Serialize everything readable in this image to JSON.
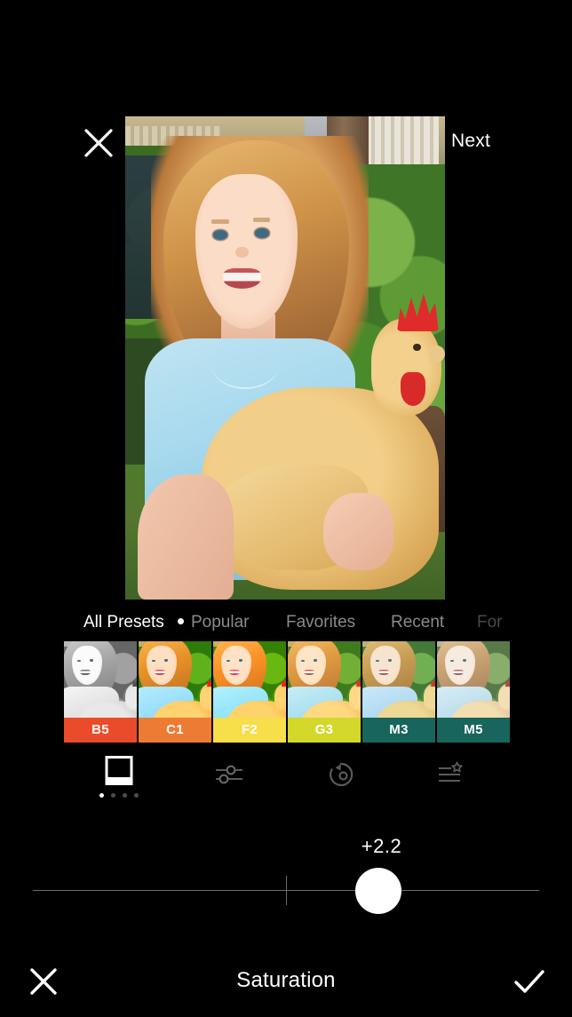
{
  "header": {
    "close_icon": "close-icon",
    "next_label": "Next"
  },
  "photo": {
    "description": "Girl in light blue shirt holding a buff chicken outdoors"
  },
  "presets_panel": {
    "tabs": [
      {
        "label": "All Presets",
        "active": true,
        "has_dot": false,
        "dim": false
      },
      {
        "label": "Popular",
        "active": false,
        "has_dot": true,
        "dim": false
      },
      {
        "label": "Favorites",
        "active": false,
        "has_dot": false,
        "dim": false
      },
      {
        "label": "Recent",
        "active": false,
        "has_dot": false,
        "dim": false
      },
      {
        "label": "For",
        "active": false,
        "has_dot": false,
        "dim": true
      }
    ],
    "presets": [
      {
        "code": "B5",
        "color": "#EA4B2B",
        "label_color": "#ffffff"
      },
      {
        "code": "C1",
        "color": "#EE7B33",
        "label_color": "#ffffff"
      },
      {
        "code": "F2",
        "color": "#F7DE4B",
        "label_color": "#ffffff"
      },
      {
        "code": "G3",
        "color": "#D4D82B",
        "label_color": "#ffffff"
      },
      {
        "code": "M3",
        "color": "#17655C",
        "label_color": "#ffffff"
      },
      {
        "code": "M5",
        "color": "#17655C",
        "label_color": "#ffffff"
      }
    ]
  },
  "toolbar": {
    "items": [
      {
        "name": "presets-tool",
        "icon": "polaroid-icon",
        "active": true,
        "dots": 4,
        "active_dot": 1
      },
      {
        "name": "adjust-tool",
        "icon": "sliders-icon",
        "active": false
      },
      {
        "name": "history-tool",
        "icon": "undo-circle-icon",
        "active": false
      },
      {
        "name": "effects-tool",
        "icon": "star-list-icon",
        "active": false
      }
    ]
  },
  "slider": {
    "value_label": "+2.2",
    "value": 2.2,
    "min": -6,
    "max": 6,
    "center_tick": 0
  },
  "footer": {
    "cancel_icon": "close-icon",
    "title": "Saturation",
    "confirm_icon": "check-icon"
  }
}
